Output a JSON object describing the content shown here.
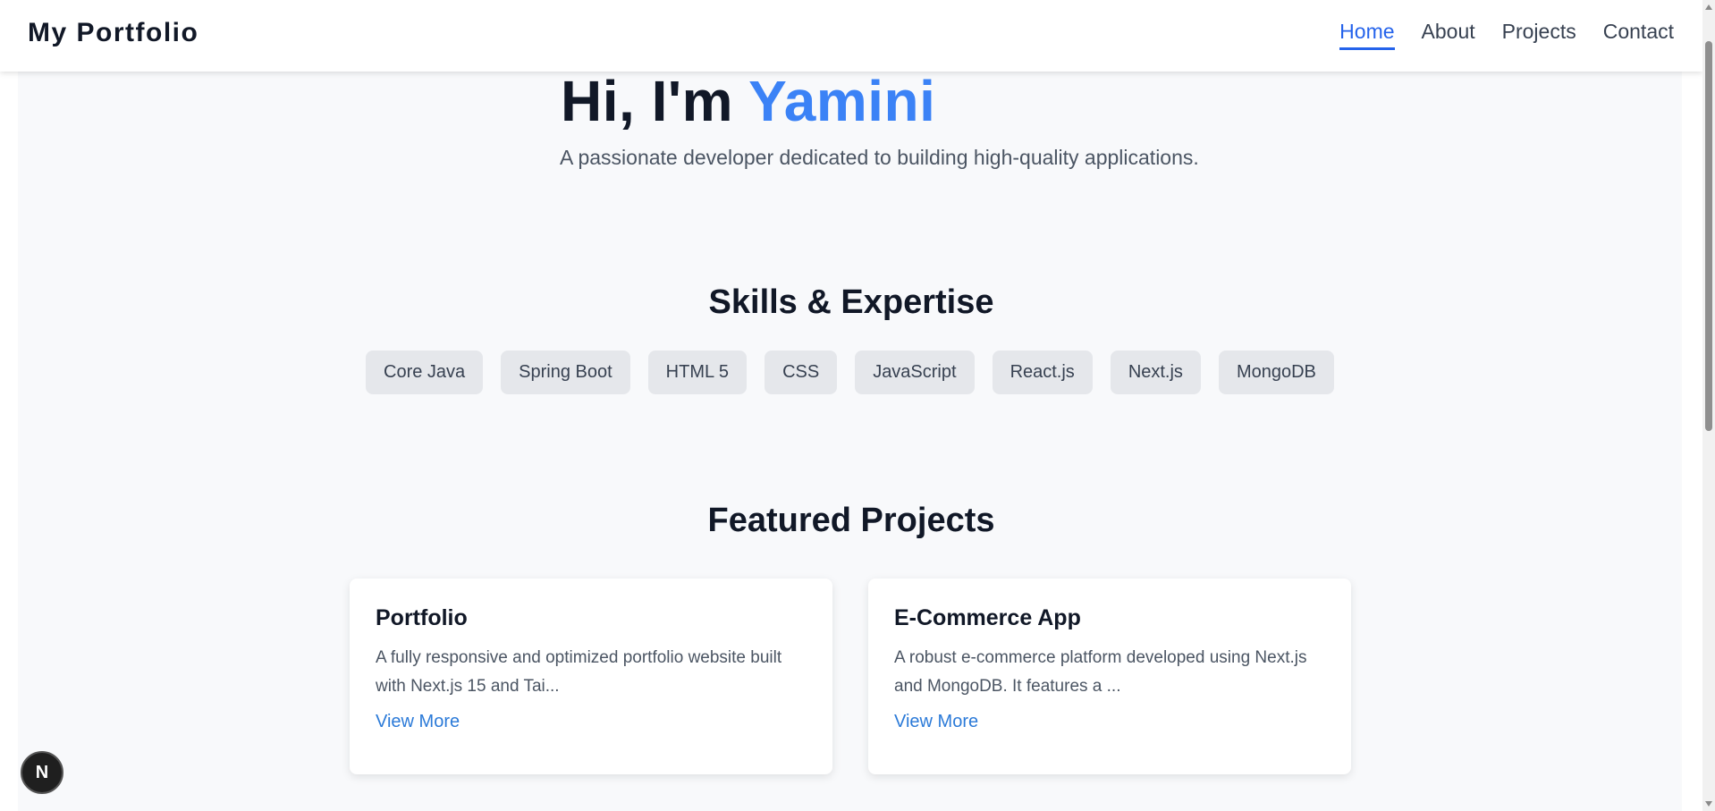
{
  "navbar": {
    "brand": "My Portfolio",
    "links": [
      {
        "label": "Home",
        "active": true
      },
      {
        "label": "About",
        "active": false
      },
      {
        "label": "Projects",
        "active": false
      },
      {
        "label": "Contact",
        "active": false
      }
    ]
  },
  "hero": {
    "greeting": "Hi, I'm ",
    "name": "Yamini",
    "subtitle": "A passionate developer dedicated to building high-quality applications."
  },
  "skills": {
    "title": "Skills & Expertise",
    "items": [
      "Core Java",
      "Spring Boot",
      "HTML 5",
      "CSS",
      "JavaScript",
      "React.js",
      "Next.js",
      "MongoDB"
    ]
  },
  "projects": {
    "title": "Featured Projects",
    "items": [
      {
        "title": "Portfolio",
        "description": "A fully responsive and optimized portfolio website built with Next.js 15 and Tai...",
        "link_label": "View More"
      },
      {
        "title": "E-Commerce App",
        "description": "A robust e-commerce platform developed using Next.js and MongoDB. It features a ...",
        "link_label": "View More"
      }
    ]
  },
  "dev_badge": {
    "label": "N",
    "icon": "nextjs-logo-icon"
  },
  "colors": {
    "accent": "#3b82f6",
    "nav_active": "#2563eb",
    "link": "#2b7ad8",
    "heading": "#111827",
    "background": "#f8f9fb"
  }
}
